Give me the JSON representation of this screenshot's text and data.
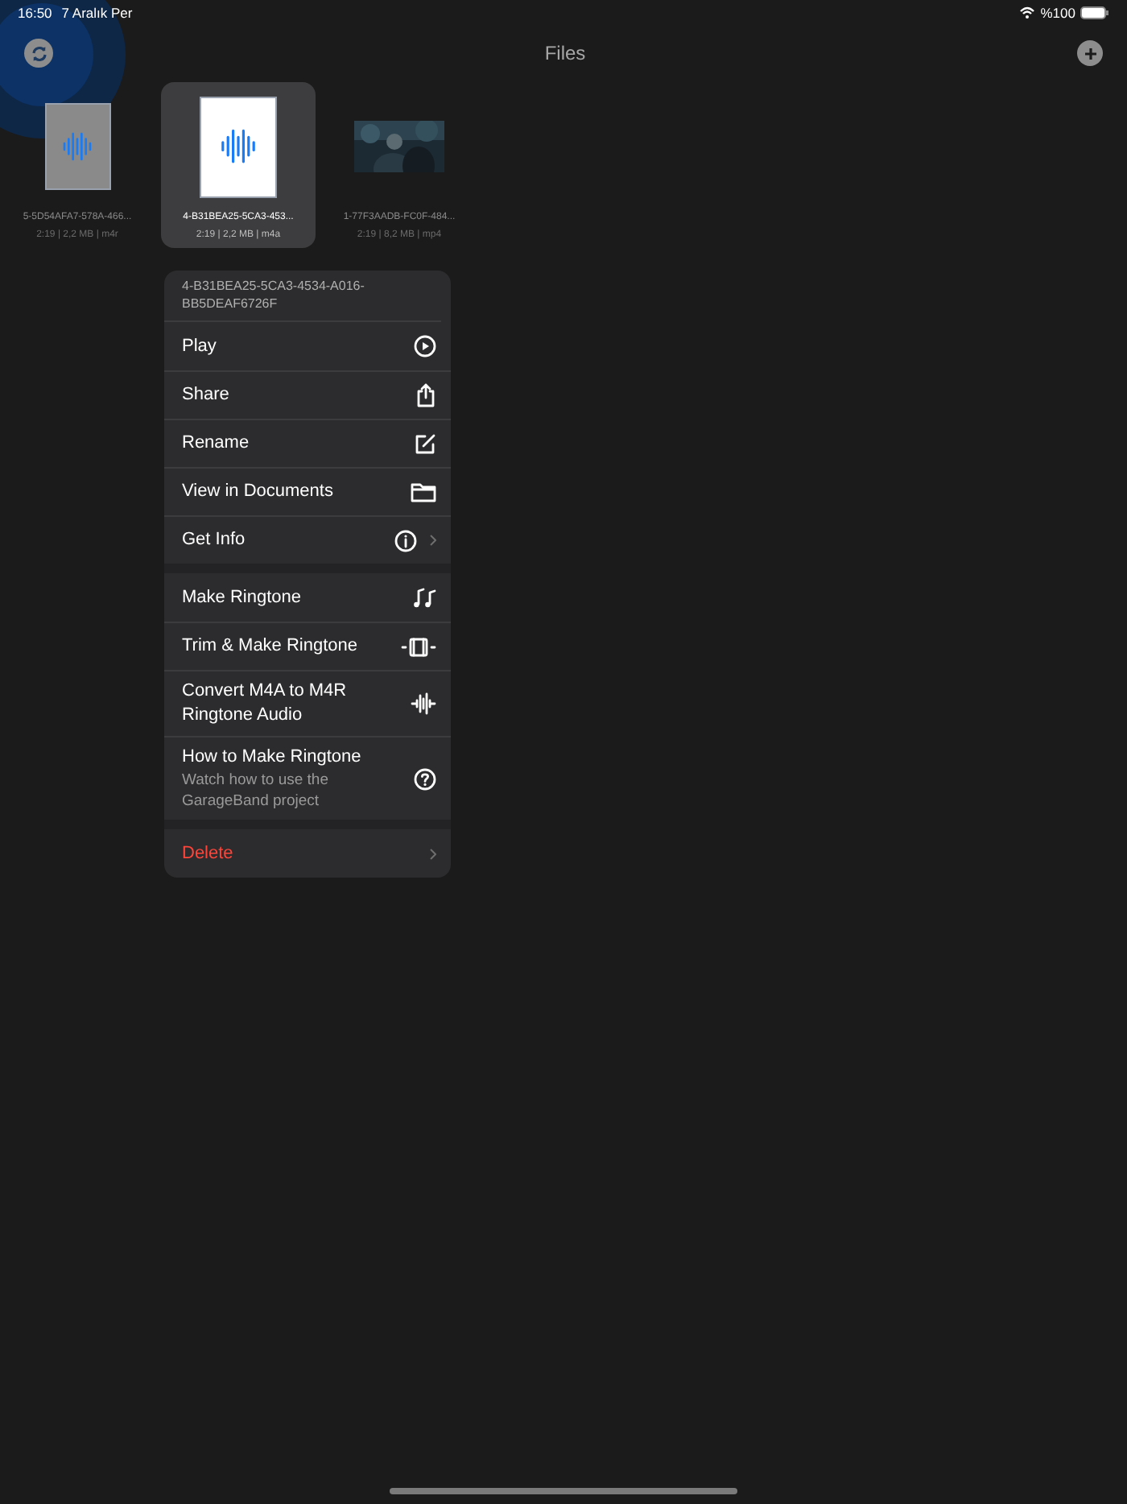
{
  "status_bar": {
    "time": "16:50",
    "date": "7 Aralık Per",
    "battery": "%100"
  },
  "nav": {
    "title": "Files"
  },
  "files": [
    {
      "kind": "audio",
      "name": "5-5D54AFA7-578A-466...",
      "meta": "2:19 | 2,2 MB | m4r",
      "selected": false,
      "dimmed": true
    },
    {
      "kind": "audio",
      "name": "4-B31BEA25-5CA3-453...",
      "meta": "2:19 | 2,2 MB | m4a",
      "selected": true,
      "dimmed": false
    },
    {
      "kind": "video",
      "name": "1-77F3AADB-FC0F-484...",
      "meta": "2:19 | 8,2 MB | mp4",
      "selected": false,
      "dimmed": false
    }
  ],
  "menu": {
    "header": "4-B31BEA25-5CA3-4534-A016-BB5DEAF6726F",
    "groups": [
      [
        {
          "label": "Play"
        },
        {
          "label": "Share"
        },
        {
          "label": "Rename"
        },
        {
          "label": "View in Documents"
        },
        {
          "label": "Get Info",
          "submenu": true
        }
      ],
      [
        {
          "label": "Make Ringtone"
        },
        {
          "label": "Trim & Make Ringtone"
        },
        {
          "label": "Convert M4A to M4R Ringtone Audio"
        },
        {
          "label": "How to Make Ringtone",
          "subtitle": "Watch how to use the GarageBand project"
        }
      ],
      [
        {
          "label": "Delete",
          "destructive": true,
          "submenu": true
        }
      ]
    ]
  }
}
